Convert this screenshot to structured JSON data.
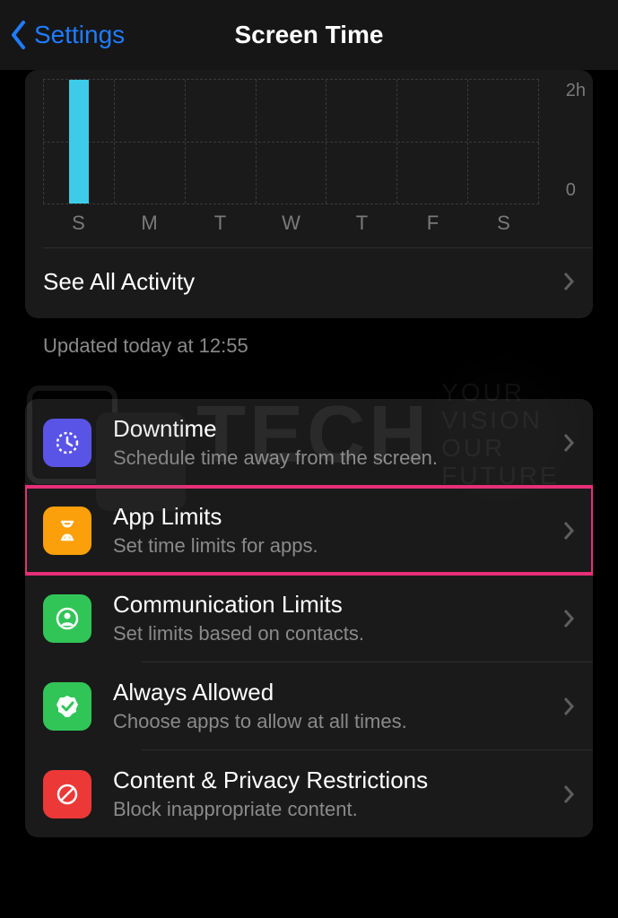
{
  "nav": {
    "back_label": "Settings",
    "title": "Screen Time"
  },
  "chart_data": {
    "type": "bar",
    "categories": [
      "S",
      "M",
      "T",
      "W",
      "T",
      "F",
      "S"
    ],
    "values": [
      2,
      0,
      0,
      0,
      0,
      0,
      0
    ],
    "ylabel_marks": [
      "2h",
      "0"
    ],
    "ylim": [
      0,
      2
    ]
  },
  "activity": {
    "see_all_label": "See All Activity",
    "updated_label": "Updated today at 12:55"
  },
  "rows": {
    "downtime": {
      "title": "Downtime",
      "sub": "Schedule time away from the screen."
    },
    "applimits": {
      "title": "App Limits",
      "sub": "Set time limits for apps."
    },
    "comm": {
      "title": "Communication Limits",
      "sub": "Set limits based on contacts."
    },
    "always": {
      "title": "Always Allowed",
      "sub": "Choose apps to allow at all times."
    },
    "content": {
      "title": "Content & Privacy Restrictions",
      "sub": "Block inappropriate content."
    }
  },
  "watermark": {
    "brand": "TECH",
    "tag1": "YOUR VISION",
    "tag2": "OUR FUTURE"
  }
}
